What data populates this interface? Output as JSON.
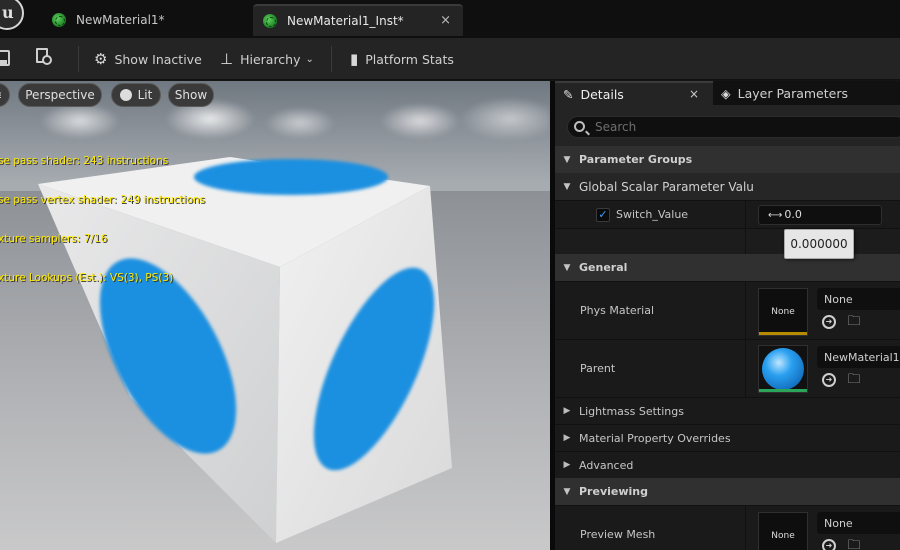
{
  "tabs": [
    {
      "label": "NewMaterial1*"
    },
    {
      "label": "NewMaterial1_Inst*",
      "close": "×"
    }
  ],
  "toolbar": {
    "show_inactive": "Show Inactive",
    "hierarchy": "Hierarchy",
    "platform_stats": "Platform Stats"
  },
  "viewport": {
    "buttons": {
      "perspective": "Perspective",
      "lit": "Lit",
      "show": "Show"
    },
    "stats": [
      "se pass shader: 243 instructions",
      "se pass vertex shader: 249 instructions",
      "xture samplers: 7/16",
      "xture Lookups (Est.): VS(3), PS(3)"
    ]
  },
  "panel": {
    "tabs": {
      "details": "Details",
      "details_close": "×",
      "layer_parameters": "Layer Parameters"
    },
    "search_placeholder": "Search",
    "categories": {
      "parameter_groups": "Parameter Groups",
      "global_scalar": "Global Scalar Parameter Valu",
      "general": "General",
      "previewing": "Previewing"
    },
    "switch_value": {
      "label": "Switch_Value",
      "checked": true,
      "field_value": "0.0",
      "tooltip": "0.000000"
    },
    "phys_material": {
      "label": "Phys Material",
      "thumb": "None",
      "value": "None"
    },
    "parent": {
      "label": "Parent",
      "value": "NewMaterial1"
    },
    "collapsed": {
      "lightmass": "Lightmass Settings",
      "overrides": "Material Property Overrides",
      "advanced": "Advanced"
    },
    "preview_mesh": {
      "label": "Preview Mesh",
      "thumb": "None",
      "value": "None"
    }
  },
  "colors": {
    "accent_blue": "#3aa0ff",
    "sphere_blue": "#1e90e0",
    "thumb_bar_gold": "#b58b00",
    "thumb_bar_green": "#2aa55a"
  }
}
